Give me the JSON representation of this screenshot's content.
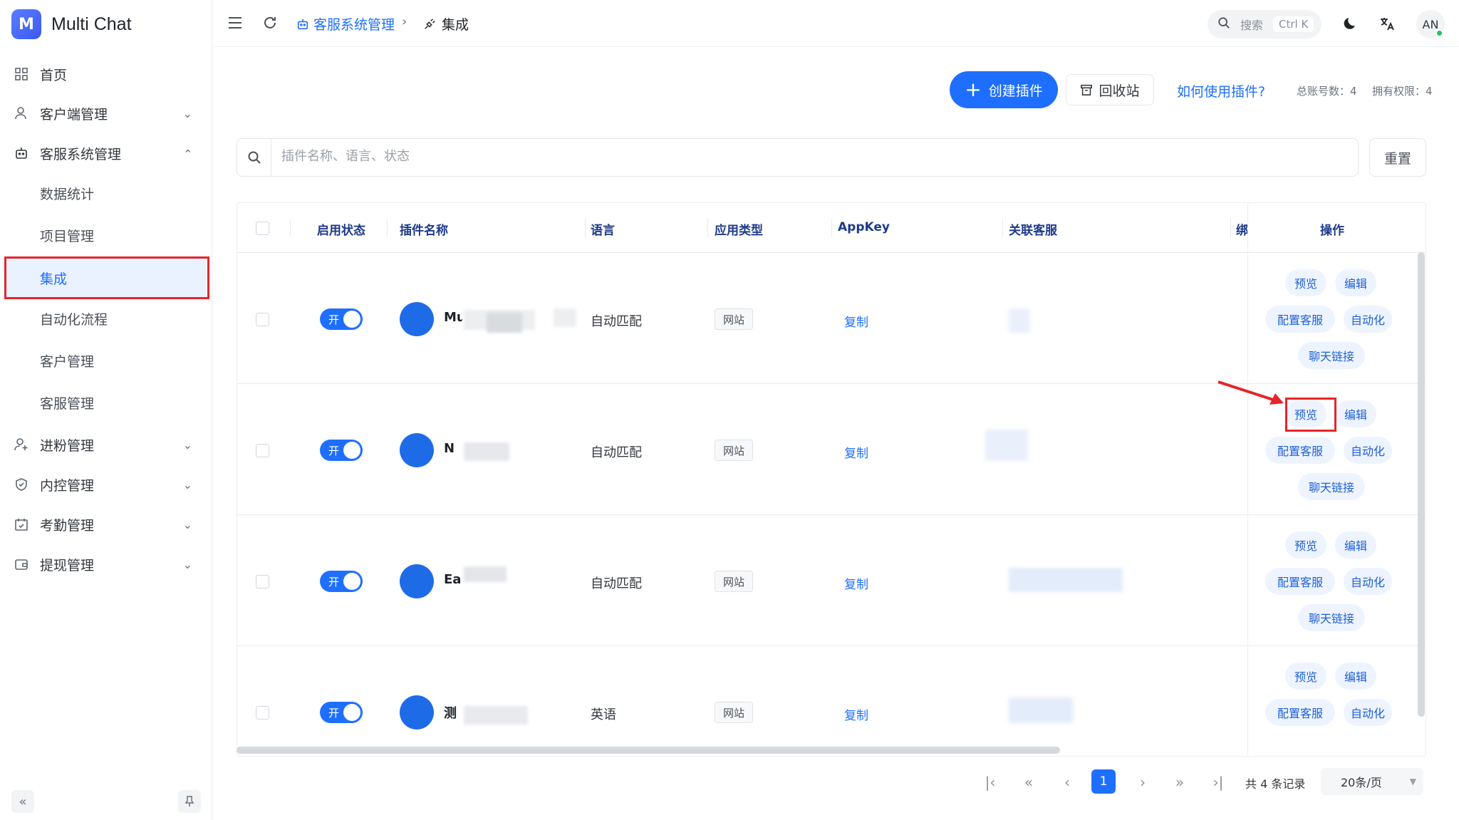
{
  "app": {
    "title": "Multi Chat",
    "logo_letter": "M"
  },
  "sidebar": {
    "items": [
      {
        "label": "首页",
        "icon": "dashboard-icon"
      },
      {
        "label": "客户端管理",
        "icon": "user-icon"
      },
      {
        "label": "客服系统管理",
        "icon": "robot-icon"
      },
      {
        "label": "进粉管理",
        "icon": "user-add-icon"
      },
      {
        "label": "内控管理",
        "icon": "shield-icon"
      },
      {
        "label": "考勤管理",
        "icon": "calendar-check-icon"
      },
      {
        "label": "提现管理",
        "icon": "wallet-icon"
      }
    ],
    "subitems": [
      "数据统计",
      "项目管理",
      "集成",
      "自动化流程",
      "客户管理",
      "客服管理"
    ],
    "active_subitem": "集成"
  },
  "header": {
    "breadcrumb": [
      "客服系统管理",
      "集成"
    ],
    "search_label": "搜索",
    "search_shortcut": "Ctrl K",
    "avatar_initials": "AN"
  },
  "toolbar": {
    "create_label": "创建插件",
    "recycle_label": "回收站",
    "help_label": "如何使用插件?",
    "total_accounts": "总账号数：4",
    "permissions": "拥有权限：4"
  },
  "filter": {
    "placeholder": "插件名称、语言、状态",
    "reset_label": "重置"
  },
  "table": {
    "columns": [
      "启用状态",
      "插件名称",
      "语言",
      "应用类型",
      "AppKey",
      "关联客服",
      "绑",
      "操作"
    ],
    "rows": [
      {
        "status": "开",
        "name_visible": "Mu",
        "language": "自动匹配",
        "app_type": "网站",
        "appkey": "复制"
      },
      {
        "status": "开",
        "name_visible": "N",
        "language": "自动匹配",
        "app_type": "网站",
        "appkey": "复制"
      },
      {
        "status": "开",
        "name_visible": "Eai",
        "language": "自动匹配",
        "app_type": "网站",
        "appkey": "复制"
      },
      {
        "status": "开",
        "name_visible": "测",
        "language": "英语",
        "app_type": "网站",
        "appkey": "复制"
      }
    ],
    "actions": [
      "预览",
      "编辑",
      "配置客服",
      "自动化",
      "聊天链接"
    ]
  },
  "pagination": {
    "current_page": "1",
    "total_text": "共 4 条记录",
    "page_size": "20条/页"
  },
  "colors": {
    "accent": "#1e6fff",
    "highlight": "#e5252a"
  }
}
